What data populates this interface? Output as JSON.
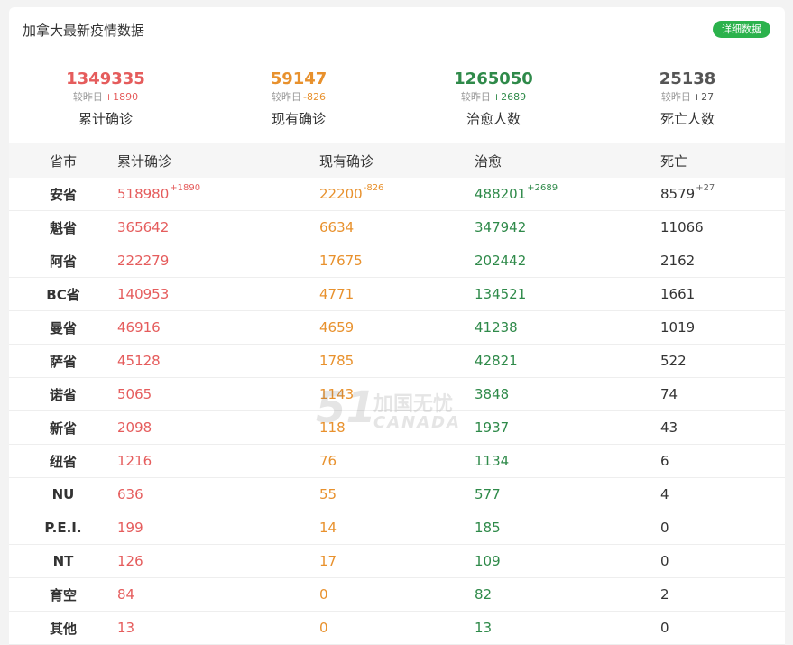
{
  "header": {
    "title": "加拿大最新疫情数据",
    "detail_button": "详细数据"
  },
  "summary": [
    {
      "value": "1349335",
      "delta_prefix": "较昨日",
      "delta": "+1890",
      "label": "累计确诊",
      "color": "#e55c5c"
    },
    {
      "value": "59147",
      "delta_prefix": "较昨日",
      "delta": "-826",
      "label": "现有确诊",
      "color": "#e8912d"
    },
    {
      "value": "1265050",
      "delta_prefix": "较昨日",
      "delta": "+2689",
      "label": "治愈人数",
      "color": "#2f8a4a"
    },
    {
      "value": "25138",
      "delta_prefix": "较昨日",
      "delta": "+27",
      "label": "死亡人数",
      "color": "#555555"
    }
  ],
  "table": {
    "headers": [
      "省市",
      "累计确诊",
      "现有确诊",
      "治愈",
      "死亡"
    ],
    "rows": [
      {
        "name": "安省",
        "total": "518980",
        "total_delta": "+1890",
        "current": "22200",
        "current_delta": "-826",
        "recovered": "488201",
        "recovered_delta": "+2689",
        "deaths": "8579",
        "deaths_delta": "+27"
      },
      {
        "name": "魁省",
        "total": "365642",
        "current": "6634",
        "recovered": "347942",
        "deaths": "11066"
      },
      {
        "name": "阿省",
        "total": "222279",
        "current": "17675",
        "recovered": "202442",
        "deaths": "2162"
      },
      {
        "name": "BC省",
        "total": "140953",
        "current": "4771",
        "recovered": "134521",
        "deaths": "1661"
      },
      {
        "name": "曼省",
        "total": "46916",
        "current": "4659",
        "recovered": "41238",
        "deaths": "1019"
      },
      {
        "name": "萨省",
        "total": "45128",
        "current": "1785",
        "recovered": "42821",
        "deaths": "522"
      },
      {
        "name": "诺省",
        "total": "5065",
        "current": "1143",
        "recovered": "3848",
        "deaths": "74"
      },
      {
        "name": "新省",
        "total": "2098",
        "current": "118",
        "recovered": "1937",
        "deaths": "43"
      },
      {
        "name": "纽省",
        "total": "1216",
        "current": "76",
        "recovered": "1134",
        "deaths": "6"
      },
      {
        "name": "NU",
        "total": "636",
        "current": "55",
        "recovered": "577",
        "deaths": "4"
      },
      {
        "name": "P.E.I.",
        "total": "199",
        "current": "14",
        "recovered": "185",
        "deaths": "0"
      },
      {
        "name": "NT",
        "total": "126",
        "current": "17",
        "recovered": "109",
        "deaths": "0"
      },
      {
        "name": "育空",
        "total": "84",
        "current": "0",
        "recovered": "82",
        "deaths": "2"
      },
      {
        "name": "其他",
        "total": "13",
        "current": "0",
        "recovered": "13",
        "deaths": "0"
      }
    ]
  },
  "watermark": {
    "big": "51",
    "cn": "加国无忧",
    "en": "CANADA"
  },
  "colors": {
    "confirmed": "#e55c5c",
    "current": "#e8912d",
    "recovered": "#2f8a4a",
    "deaths": "#555555",
    "button": "#2bb24c"
  }
}
